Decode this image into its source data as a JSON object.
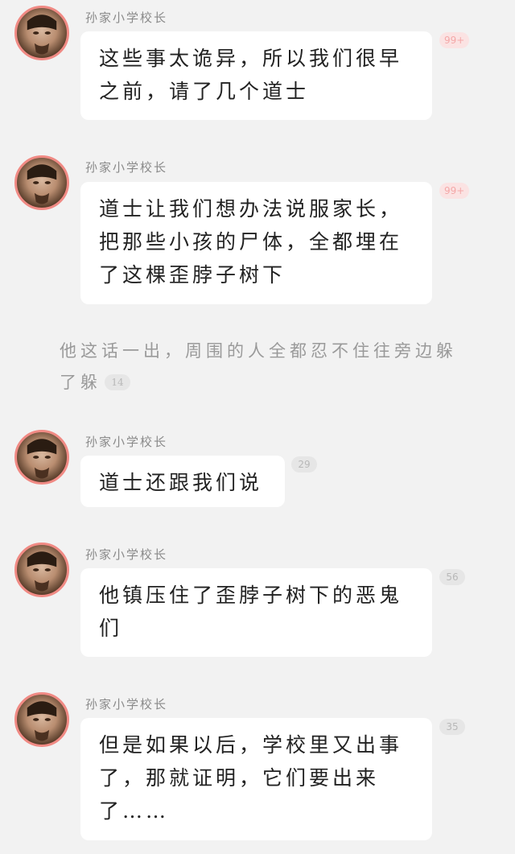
{
  "messages": [
    {
      "sender": "孙家小学校长",
      "text": "这些事太诡异，所以我们很早之前，请了几个道士",
      "count": "99+",
      "hot": true
    },
    {
      "sender": "孙家小学校长",
      "text": "道士让我们想办法说服家长，把那些小孩的尸体，全都埋在了这棵歪脖子树下",
      "count": "99+",
      "hot": true
    },
    {
      "sender": "孙家小学校长",
      "text": "道士还跟我们说",
      "count": "29",
      "hot": false
    },
    {
      "sender": "孙家小学校长",
      "text": "他镇压住了歪脖子树下的恶鬼们",
      "count": "56",
      "hot": false
    },
    {
      "sender": "孙家小学校长",
      "text": "但是如果以后，学校里又出事了，那就证明，它们要出来了……",
      "count": "35",
      "hot": false
    }
  ],
  "narration": {
    "text": "他这话一出，周围的人全都忍不住往旁边躲了躲",
    "count": "14"
  }
}
